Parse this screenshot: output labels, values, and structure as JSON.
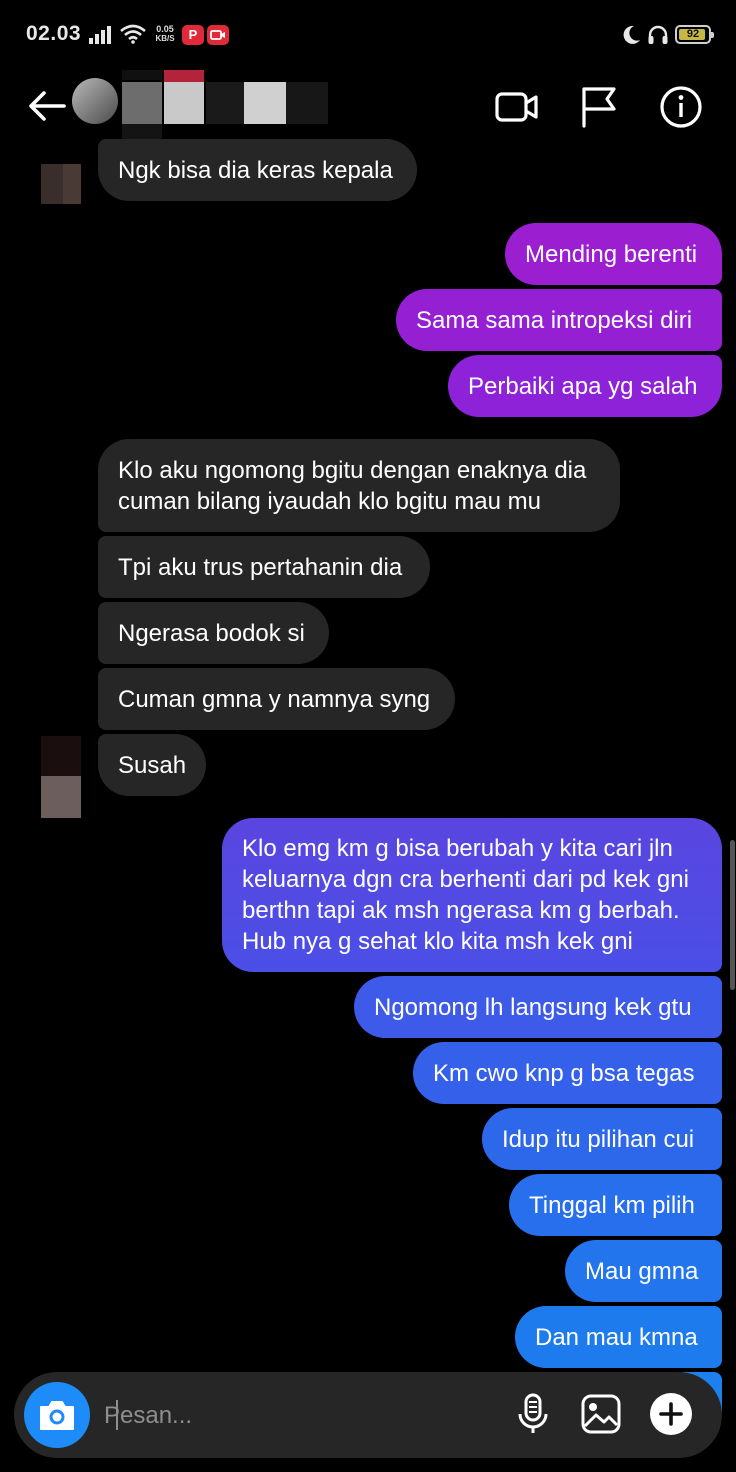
{
  "status_bar": {
    "time": "02.03",
    "speed_value": "0.05",
    "speed_unit": "KB/S",
    "battery": "92",
    "battery_level": 0.92,
    "icons": [
      "signal-icon",
      "wifi-icon",
      "pinterest-icon",
      "recorder-icon",
      "moon-icon",
      "headset-icon",
      "battery-icon"
    ]
  },
  "header": {
    "icons": [
      "back-arrow-icon",
      "video-call-icon",
      "flag-icon",
      "info-icon"
    ]
  },
  "messages": [
    {
      "side": "in",
      "text": "Ngk bisa dia keras kepala"
    },
    {
      "side": "out",
      "text": "Mending berenti"
    },
    {
      "side": "out",
      "text": "Sama sama intropeksi diri"
    },
    {
      "side": "out",
      "text": "Perbaiki apa yg salah"
    },
    {
      "side": "in",
      "text": "Klo aku ngomong bgitu dengan enaknya dia cuman bilang iyaudah klo bgitu mau mu"
    },
    {
      "side": "in",
      "text": "Tpi aku trus pertahanin dia"
    },
    {
      "side": "in",
      "text": "Ngerasa bodok si"
    },
    {
      "side": "in",
      "text": "Cuman gmna y namnya syng"
    },
    {
      "side": "in",
      "text": "Susah"
    },
    {
      "side": "out",
      "text": "Klo emg km g bisa berubah y kita cari jln keluarnya dgn cra berhenti dari pd kek gni berthn tapi ak msh ngerasa km g berbah. Hub nya g sehat klo kita msh kek gni"
    },
    {
      "side": "out",
      "text": "Ngomong lh langsung kek gtu"
    },
    {
      "side": "out",
      "text": "Km cwo knp g bsa tegas"
    },
    {
      "side": "out",
      "text": "Idup itu pilihan cui"
    },
    {
      "side": "out",
      "text": "Tinggal km pilih"
    },
    {
      "side": "out",
      "text": "Mau gmna"
    },
    {
      "side": "out",
      "text": "Dan mau kmna"
    }
  ],
  "composer": {
    "placeholder": "Pesan...",
    "icons": [
      "camera-icon",
      "microphone-icon",
      "gallery-icon",
      "plus-icon"
    ]
  },
  "colors": {
    "bubble_in": "#262626",
    "accent_blue": "#1d8cf8",
    "outgoing_gradient": [
      "#9b1fd0",
      "#7a2ee0",
      "#3a5ce8",
      "#1e7fee"
    ]
  }
}
